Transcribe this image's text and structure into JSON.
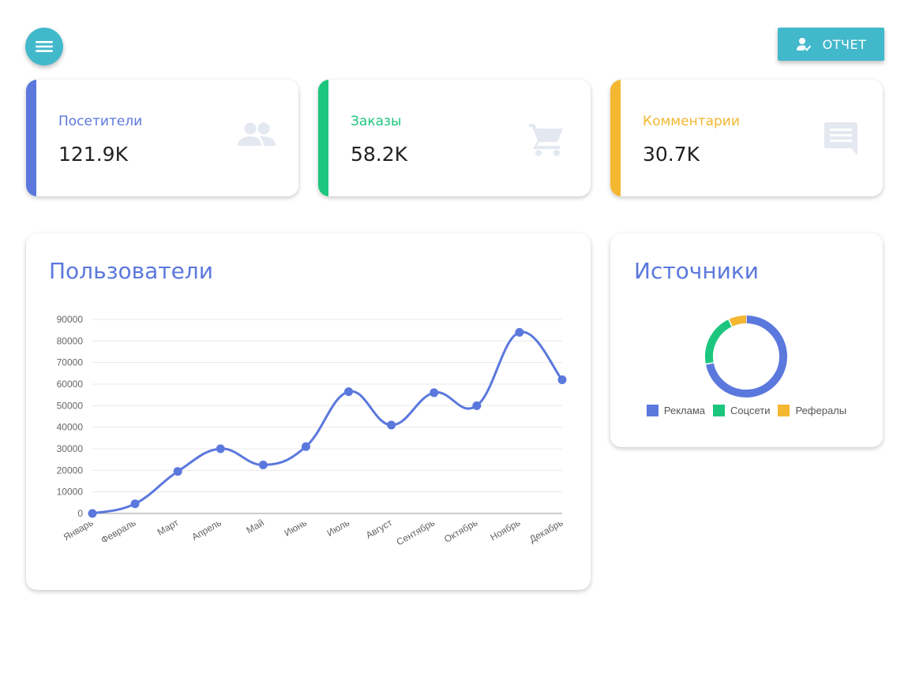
{
  "header": {
    "menu_icon": "menu-icon",
    "report_label": "ОТЧЕТ",
    "report_icon": "user-check-icon"
  },
  "stats": [
    {
      "label": "Посетители",
      "value": "121.9K",
      "color": "#5b78dd",
      "icon": "people-icon"
    },
    {
      "label": "Заказы",
      "value": "58.2K",
      "color": "#1dc67e",
      "icon": "cart-icon"
    },
    {
      "label": "Комментарии",
      "value": "30.7K",
      "color": "#f4b731",
      "icon": "comment-icon"
    }
  ],
  "users_card": {
    "title": "Пользователи"
  },
  "sources_card": {
    "title": "Источники"
  },
  "colors": {
    "accent": "#42b8cb",
    "blue": "#5b78dd",
    "green": "#1dc67e",
    "yellow": "#f4b731",
    "icon_gray": "#e4e8f0"
  },
  "chart_data": [
    {
      "type": "line",
      "title": "Пользователи",
      "categories": [
        "Январь",
        "Февраль",
        "Март",
        "Апрель",
        "Май",
        "Июнь",
        "Июль",
        "Август",
        "Сентябрь",
        "Октябрь",
        "Ноябрь",
        "Декабрь"
      ],
      "series": [
        {
          "values": [
            0,
            4500,
            19500,
            30000,
            22500,
            31000,
            56500,
            41000,
            56000,
            50000,
            84000,
            62000
          ],
          "color": "#5b78dd"
        }
      ],
      "ylim": [
        0,
        90000
      ],
      "yticks": [
        0,
        10000,
        20000,
        30000,
        40000,
        50000,
        60000,
        70000,
        80000,
        90000
      ],
      "smooth": true,
      "grid": true,
      "legend": "none"
    },
    {
      "type": "pie",
      "title": "Источники",
      "donut": true,
      "labels": [
        "Реклама",
        "Соцсети",
        "Рефералы"
      ],
      "values": [
        72,
        21,
        7
      ],
      "colors": [
        "#5b78dd",
        "#1dc67e",
        "#f4b731"
      ],
      "legend": "bottom"
    }
  ]
}
